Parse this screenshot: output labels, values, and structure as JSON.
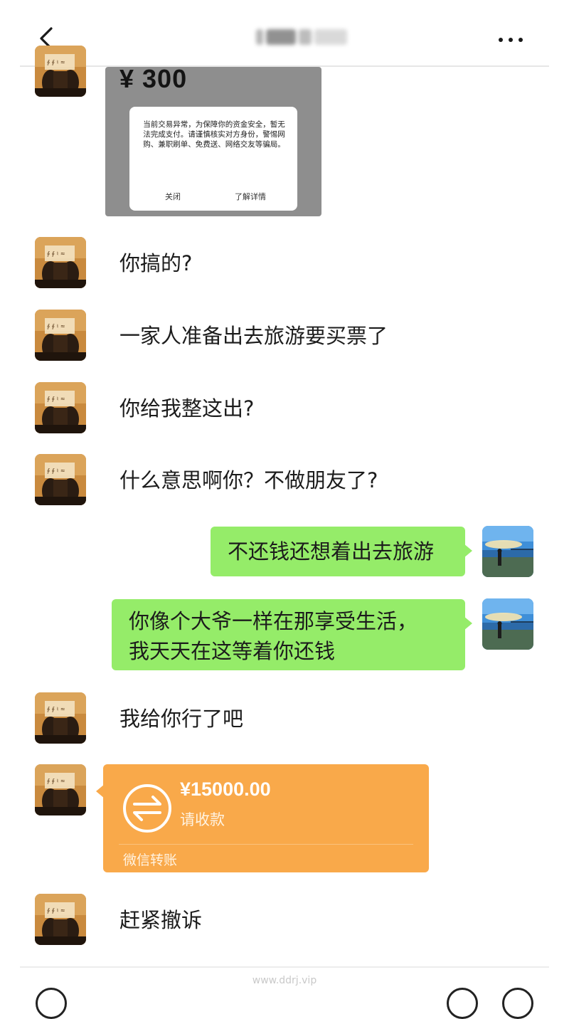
{
  "header": {
    "back_icon": "chevron-left-icon",
    "more_icon": "more-dots-icon"
  },
  "image_message": {
    "amount": "¥ 300",
    "dialog_text": "当前交易异常，为保障你的资金安全，暂无法完成支付。请谨慎核实对方身份，警惕网购、兼职刷单、免费送、网络交友等骗局。",
    "close_label": "关闭",
    "details_label": "了解详情"
  },
  "messages": [
    {
      "from": "friend",
      "text": "你搞的?"
    },
    {
      "from": "friend",
      "text": "一家人准备出去旅游要买票了"
    },
    {
      "from": "friend",
      "text": "你给我整这出?"
    },
    {
      "from": "friend",
      "text": "什么意思啊你？不做朋友了?"
    },
    {
      "from": "me",
      "text": "不还钱还想着出去旅游"
    },
    {
      "from": "me",
      "line1": "你像个大爷一样在那享受生活，",
      "line2": "我天天在这等着你还钱"
    },
    {
      "from": "friend",
      "text": "我给你行了吧"
    },
    {
      "from": "friend",
      "text": "赶紧撤诉"
    }
  ],
  "transfer": {
    "amount": "¥15000.00",
    "status": "请收款",
    "label": "微信转账",
    "icon": "transfer-arrows-icon"
  },
  "watermark": "www.ddrj.vip",
  "colors": {
    "my_bubble": "#95ec69",
    "transfer_card": "#f9a94a"
  }
}
